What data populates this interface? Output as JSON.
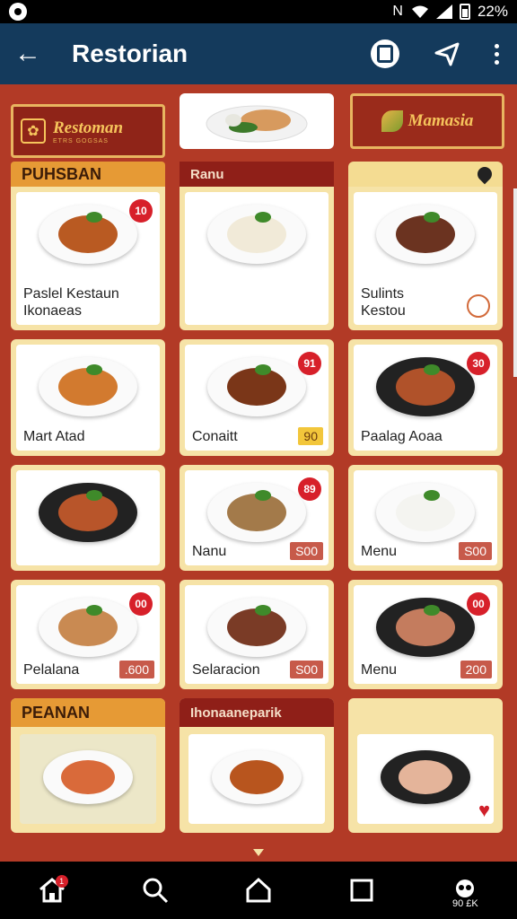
{
  "status_bar": {
    "network_glyphs": "N",
    "time": "22%"
  },
  "app_bar": {
    "title": "Restorian"
  },
  "top": {
    "left_brand_name": "Restoman",
    "left_brand_sub": "ETRS GOGSAS",
    "right_brand_name": "Mamasia"
  },
  "columns": [
    {
      "header": "PUHSBAN",
      "cards": [
        {
          "label": "Paslel Kestaun\nIkonaeas",
          "badge": "10",
          "price": "",
          "food_color": "#b95a22",
          "plate": "white"
        },
        {
          "label": "Mart Atad",
          "badge": "",
          "price": "",
          "food_color": "#d27a2f",
          "plate": "white"
        },
        {
          "label": "",
          "badge": "",
          "price": "",
          "food_color": "#b8552a",
          "plate": "dark"
        },
        {
          "label": "Pelalana",
          "badge": "00",
          "price": ".600",
          "food_color": "#c98a52",
          "plate": "white"
        }
      ],
      "footer_header": "PEANAN"
    },
    {
      "header": "Ranu",
      "cards": [
        {
          "label": "",
          "badge": "",
          "price": "",
          "food_color": "#f1ead8",
          "plate": "white"
        },
        {
          "label": "Conaitt",
          "badge": "91",
          "price": "90",
          "food_color": "#7a3618",
          "plate": "white"
        },
        {
          "label": "Nanu",
          "badge": "89",
          "price": "S00",
          "food_color": "#a37a4a",
          "plate": "white"
        },
        {
          "label": "Selaracion",
          "badge": "",
          "price": "S00",
          "food_color": "#7a3b26",
          "plate": "white"
        }
      ],
      "footer_header": "Ihonaaneparik"
    },
    {
      "header": "",
      "cards": [
        {
          "label": "Sulints\nKestou",
          "badge": "",
          "price": "",
          "food_color": "#6b3320",
          "plate": "white"
        },
        {
          "label": "Paalag Aoaa",
          "badge": "30",
          "price": "",
          "food_color": "#b0522a",
          "plate": "dark"
        },
        {
          "label": "Menu",
          "badge": "",
          "price": "S00",
          "food_color": "#f4f4f0",
          "plate": "white"
        },
        {
          "label": "Menu",
          "badge": "00",
          "price": "200",
          "food_color": "#c47c5e",
          "plate": "dark"
        }
      ],
      "footer_header": ""
    }
  ],
  "bottom_nav": {
    "home_badge": "1",
    "profile_text": "90 £K"
  }
}
